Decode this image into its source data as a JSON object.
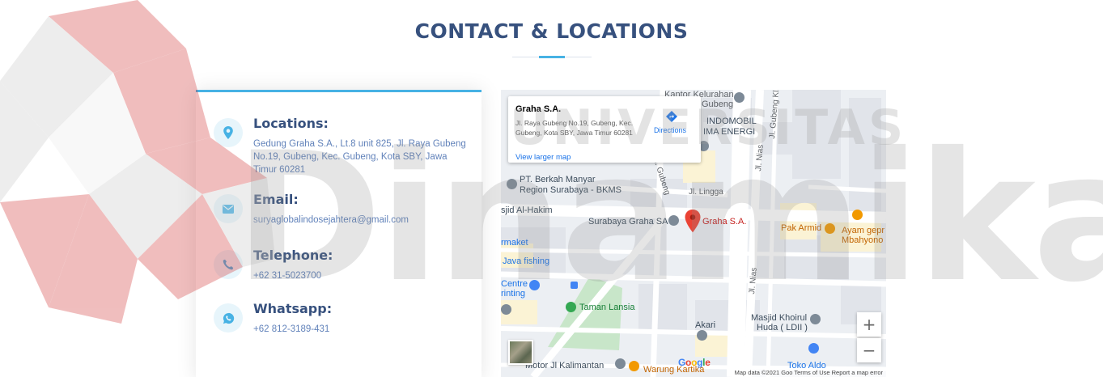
{
  "section": {
    "title": "CONTACT & LOCATIONS"
  },
  "contact": {
    "locations": {
      "heading": "Locations:",
      "text": "Gedung Graha S.A., Lt.8 unit 825, Jl. Raya Gubeng No.19, Gubeng, Kec. Gubeng, Kota SBY, Jawa Timur 60281",
      "icon": "map-pin-icon"
    },
    "email": {
      "heading": "Email:",
      "text": "suryaglobalindosejahtera@gmail.com",
      "icon": "envelope-icon"
    },
    "telephone": {
      "heading": "Telephone:",
      "text": "+62 31-5023700",
      "icon": "phone-icon"
    },
    "whatsapp": {
      "heading": "Whatsapp:",
      "text": "+62 812-3189-431",
      "icon": "whatsapp-icon"
    }
  },
  "map": {
    "info_window": {
      "title": "Graha S.A.",
      "address": "Jl. Raya Gubeng No.19, Gubeng, Kec. Gubeng, Kota SBY, Jawa Timur 60281",
      "directions_label": "Directions",
      "view_larger": "View larger map"
    },
    "labels": {
      "kantor": "Kantor Kelurahan",
      "gubeng": "Gubeng",
      "indomobil": "INDOMOBIL",
      "ima_energi": "IMA ENERGI",
      "jl_gubeng_kling": "Jl. Gubeng Kling",
      "jl_nias_top": "Jl. Nias",
      "jl_nias_bottom": "Jl. Nias",
      "jl_gubeng": "Jl. Gubeng",
      "jl_lingga": "Jl. Lingga",
      "pt_berkah_1": "PT. Berkah Manyar",
      "pt_berkah_2": "Region Surabaya - BKMS",
      "masjid_al_hakim": "sjid Al-Hakim",
      "surabaya_graha": "Surabaya Graha SA",
      "graha_marker": "Graha S.A.",
      "pak_armid": "Pak Armid",
      "ayam_1": "Ayam gepr",
      "ayam_2": "Mbahyono",
      "rmaket": "rmaket",
      "java_fishing": "Java fishing",
      "centre_1": "Centre",
      "centre_2": "rinting",
      "taman_lansia": "Taman Lansia",
      "masjid_khoirul_1": "Masjid Khoirul",
      "masjid_khoirul_2": "Huda ( LDII )",
      "akari": "Akari",
      "toko_aldo": "Toko Aldo",
      "motor": "Motor Jl Kalimantan",
      "warung": "Warung Kartika"
    },
    "zoom_in": "+",
    "zoom_out": "−",
    "google": "Google",
    "footer": "Map data ©2021 Goo  Terms of Use  Report a map error"
  },
  "watermark": {
    "text_top": "UNIVERSITAS",
    "text_main": "Dinamika"
  },
  "colors": {
    "heading": "#37517e",
    "accent": "#47b2e4",
    "body_text": "#6182ba",
    "marker": "#ea4335"
  }
}
